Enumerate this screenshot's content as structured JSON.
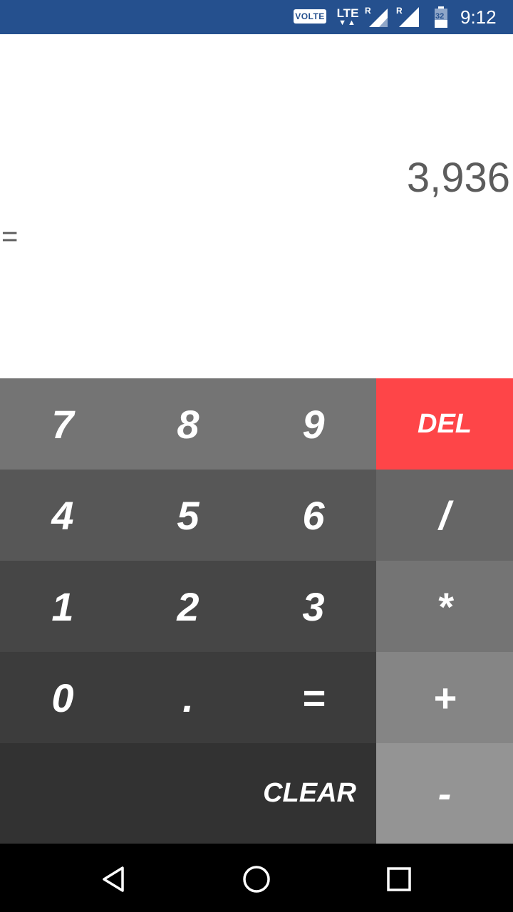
{
  "status_bar": {
    "volte": "VOLTE",
    "lte": "LTE",
    "roaming1": "R",
    "roaming2": "R",
    "battery": "32",
    "time": "9:12",
    "bg_color": "#25508e"
  },
  "display": {
    "result": "3,936",
    "equals": "="
  },
  "keypad": {
    "rows": [
      [
        "7",
        "8",
        "9"
      ],
      [
        "4",
        "5",
        "6"
      ],
      [
        "1",
        "2",
        "3"
      ],
      [
        "0",
        ".",
        "="
      ]
    ],
    "clear": "CLEAR",
    "operators": {
      "del": "DEL",
      "divide": "/",
      "multiply": "*",
      "plus": "+",
      "minus": "-"
    },
    "del_color": "#fe4548"
  },
  "navigation": {
    "icons": [
      "back-icon",
      "home-icon",
      "recents-icon"
    ]
  }
}
